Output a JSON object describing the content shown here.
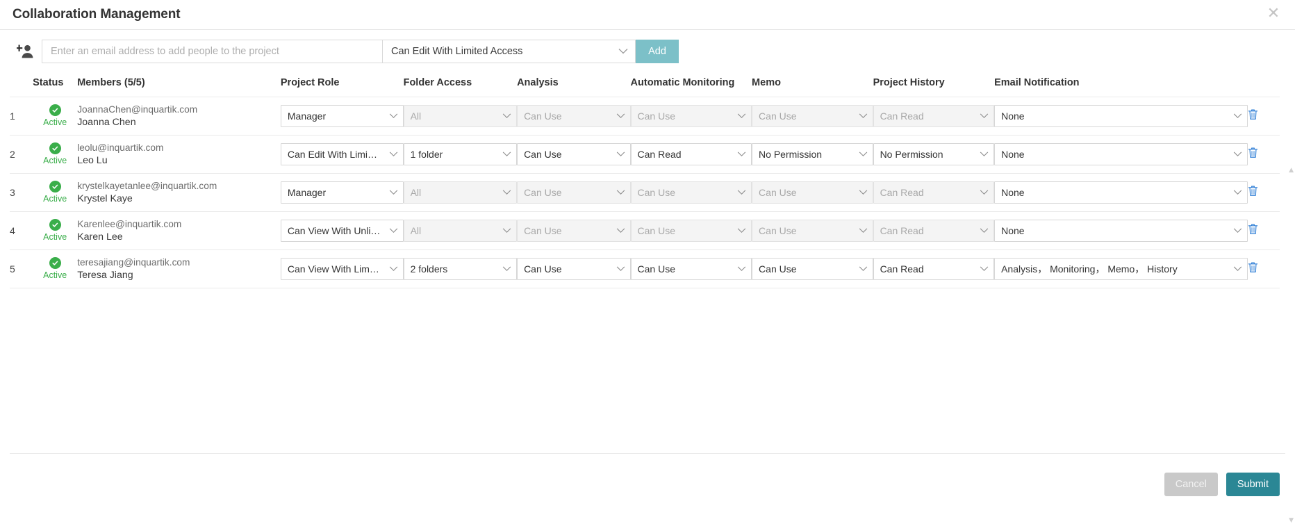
{
  "dialog": {
    "title": "Collaboration Management",
    "close_label": "✕"
  },
  "add_bar": {
    "person_icon": "add-person-icon",
    "email_placeholder": "Enter an email address to add people to the project",
    "email_value": "",
    "role_value": "Can Edit With Limited Access",
    "add_label": "Add"
  },
  "table": {
    "headers": {
      "index": "",
      "status": "Status",
      "members": "Members (5/5)",
      "project_role": "Project Role",
      "folder_access": "Folder Access",
      "analysis": "Analysis",
      "automatic_monitoring": "Automatic Monitoring",
      "memo": "Memo",
      "project_history": "Project History",
      "email_notification": "Email Notification",
      "delete": ""
    },
    "rows": [
      {
        "index": "1",
        "status": "Active",
        "email": "JoannaChen@inquartik.com",
        "name": "Joanna Chen",
        "project_role": "Manager",
        "project_role_disabled": false,
        "folder_access": "All",
        "folder_access_disabled": true,
        "analysis": "Can Use",
        "analysis_disabled": true,
        "automatic_monitoring": "Can Use",
        "automatic_monitoring_disabled": true,
        "memo": "Can Use",
        "memo_disabled": true,
        "project_history": "Can Read",
        "project_history_disabled": true,
        "email_notification": "None",
        "email_notification_disabled": false
      },
      {
        "index": "2",
        "status": "Active",
        "email": "leolu@inquartik.com",
        "name": "Leo Lu",
        "project_role": "Can Edit With Limi…",
        "project_role_disabled": false,
        "folder_access": "1 folder",
        "folder_access_disabled": false,
        "analysis": "Can Use",
        "analysis_disabled": false,
        "automatic_monitoring": "Can Read",
        "automatic_monitoring_disabled": false,
        "memo": "No Permission",
        "memo_disabled": false,
        "project_history": "No Permission",
        "project_history_disabled": false,
        "email_notification": "None",
        "email_notification_disabled": false
      },
      {
        "index": "3",
        "status": "Active",
        "email": "krystelkayetanlee@inquartik.com",
        "name": "Krystel Kaye",
        "project_role": "Manager",
        "project_role_disabled": false,
        "folder_access": "All",
        "folder_access_disabled": true,
        "analysis": "Can Use",
        "analysis_disabled": true,
        "automatic_monitoring": "Can Use",
        "automatic_monitoring_disabled": true,
        "memo": "Can Use",
        "memo_disabled": true,
        "project_history": "Can Read",
        "project_history_disabled": true,
        "email_notification": "None",
        "email_notification_disabled": false
      },
      {
        "index": "4",
        "status": "Active",
        "email": "Karenlee@inquartik.com",
        "name": "Karen Lee",
        "project_role": "Can View With Unli…",
        "project_role_disabled": false,
        "folder_access": "All",
        "folder_access_disabled": true,
        "analysis": "Can Use",
        "analysis_disabled": true,
        "automatic_monitoring": "Can Use",
        "automatic_monitoring_disabled": true,
        "memo": "Can Use",
        "memo_disabled": true,
        "project_history": "Can Read",
        "project_history_disabled": true,
        "email_notification": "None",
        "email_notification_disabled": false
      },
      {
        "index": "5",
        "status": "Active",
        "email": "teresajiang@inquartik.com",
        "name": "Teresa Jiang",
        "project_role": "Can View With Lim…",
        "project_role_disabled": false,
        "folder_access": "2 folders",
        "folder_access_disabled": false,
        "analysis": "Can Use",
        "analysis_disabled": false,
        "automatic_monitoring": "Can Use",
        "automatic_monitoring_disabled": false,
        "memo": "Can Use",
        "memo_disabled": false,
        "project_history": "Can Read",
        "project_history_disabled": false,
        "email_notification": "Analysis， Monitoring， Memo， History",
        "email_notification_disabled": false
      }
    ]
  },
  "scroll": {
    "up_arrow": "▲",
    "down_arrow": "▼"
  },
  "footer": {
    "cancel_label": "Cancel",
    "submit_label": "Submit"
  },
  "colors": {
    "accent_teal": "#2b8795",
    "add_button_teal": "#7cc0c8",
    "status_green": "#3aae4a",
    "trash_blue": "#2f7fd6",
    "cancel_gray": "#c9c9c9"
  }
}
